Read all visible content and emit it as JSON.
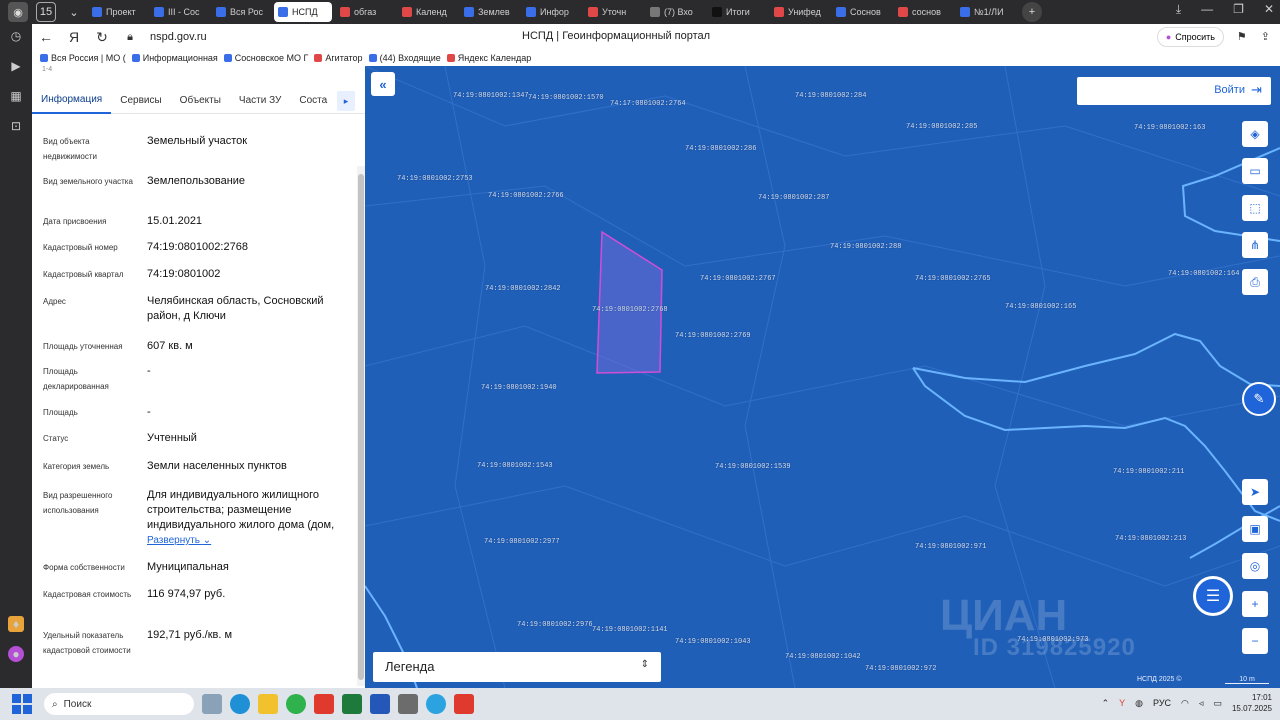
{
  "browser": {
    "tabs": [
      {
        "label": "Проект",
        "color": "#3a6ee8"
      },
      {
        "label": "III - Сос",
        "color": "#3a6ee8"
      },
      {
        "label": "Вся Рос",
        "color": "#3a6ee8"
      },
      {
        "label": "НСПД",
        "color": "#3a6ee8",
        "active": true
      },
      {
        "label": "обгаз",
        "color": "#e04848"
      },
      {
        "label": "Календ",
        "color": "#e04848"
      },
      {
        "label": "Землев",
        "color": "#3a6ee8"
      },
      {
        "label": "Инфор",
        "color": "#3a6ee8"
      },
      {
        "label": "Уточн",
        "color": "#e04848"
      },
      {
        "label": "(7) Вхо",
        "color": "#777777"
      },
      {
        "label": "Итоги",
        "color": "#111111"
      },
      {
        "label": "Унифед",
        "color": "#e04848"
      },
      {
        "label": "Соснов",
        "color": "#3a6ee8"
      },
      {
        "label": "соснов",
        "color": "#e04848"
      },
      {
        "label": "№1/ЛИ",
        "color": "#3a6ee8"
      }
    ],
    "tab_count_badge": "15",
    "url": "nspd.gov.ru",
    "page_title": "НСПД | Геоинформационный портал",
    "ask_label": "Спросить",
    "bookmarks": [
      "Вся Россия | МО (",
      "Информационная",
      "Сосновское МО Г",
      "Агитатор",
      "(44) Входящие",
      "Яндекс Календар"
    ]
  },
  "panel": {
    "tabs": [
      "Информация",
      "Сервисы",
      "Объекты",
      "Части ЗУ",
      "Соста"
    ],
    "rows": [
      {
        "label": "Вид объекта недвижимости",
        "value": "Земельный участок"
      },
      {
        "label": "Вид земельного участка",
        "value": "Землепользование"
      },
      {
        "label": "Дата присвоения",
        "value": "15.01.2021"
      },
      {
        "label": "Кадастровый номер",
        "value": "74:19:0801002:2768"
      },
      {
        "label": "Кадастровый квартал",
        "value": "74:19:0801002"
      },
      {
        "label": "Адрес",
        "value": "Челябинская область, Сосновский район, д Ключи"
      },
      {
        "label": "Площадь уточненная",
        "value": "607 кв. м"
      },
      {
        "label": "Площадь декларированная",
        "value": "-"
      },
      {
        "label": "Площадь",
        "value": "-"
      },
      {
        "label": "Статус",
        "value": "Учтенный"
      },
      {
        "label": "Категория земель",
        "value": "Земли населенных пунктов"
      },
      {
        "label": "Вид разрешенного использования",
        "value": "Для индивидуального жилищного строительства; размещение индивидуального жилого дома (дом,"
      },
      {
        "label": "Форма собственности",
        "value": "Муниципальная"
      },
      {
        "label": "Кадастровая стоимость",
        "value": "116 974,97 руб."
      },
      {
        "label": "Удельный показатель кадастровой стоимости",
        "value": "192,71 руб./кв. м"
      }
    ],
    "expand_label": "Развернуть"
  },
  "map": {
    "login_label": "Войти",
    "legend_label": "Легенда",
    "copyright": "НСПД 2025 ©",
    "scale_label": "10 m",
    "watermark": "ЦИАН",
    "watermark_id": "ID 319825920",
    "parcel_labels": [
      "74:19:0801002:1347",
      "74:19:0801002:1570",
      "74:17:0801002:2764",
      "74:19:0801002:284",
      "74:19:0801002:285",
      "74:19:0801002:163",
      "74:19:0801002:286",
      "74:19:0801002:2753",
      "74:19:0801002:2766",
      "74:19:0801002:287",
      "74:19:0801002:288",
      "74:19:0801002:2767",
      "74:19:0801002:2765",
      "74:19:0801002:164",
      "74:19:0801002:2842",
      "74:19:0801002:2768",
      "74:19:0801002:165",
      "74:19:0801002:2769",
      "74:19:0801002:1940",
      "74:19:0801002:1543",
      "74:19:0801002:1539",
      "74:19:0801002:211",
      "74:19:0801002:2977",
      "74:19:0801002:971",
      "74:19:0801002:213",
      "74:19:0801002:2976",
      "74:19:0801002:1141",
      "74:19:0801002:1043",
      "74:19:0801002:1042",
      "74:19:0801002:973",
      "74:19:0801002:972"
    ]
  },
  "taskbar": {
    "search_label": "Поиск",
    "lang": "РУС",
    "time": "17:01",
    "date": "15.07.2025"
  }
}
